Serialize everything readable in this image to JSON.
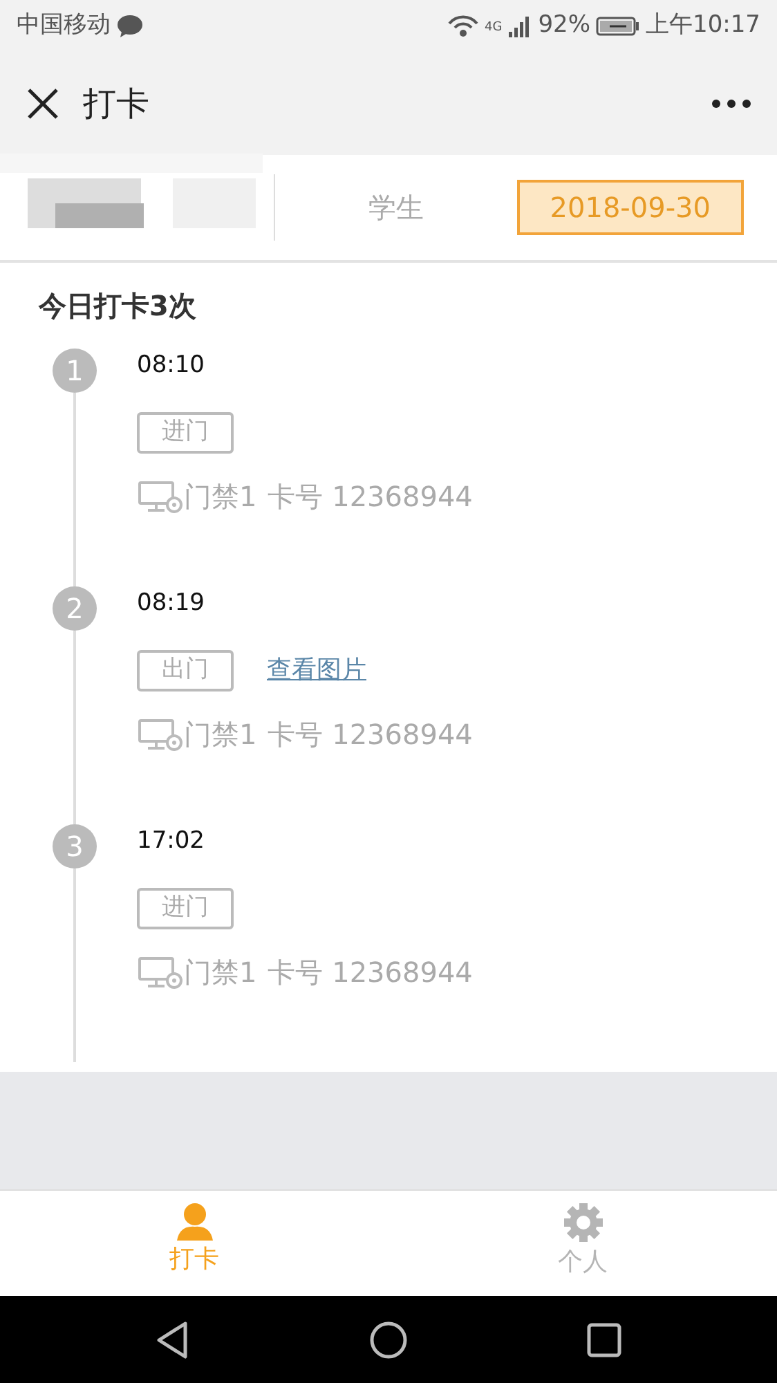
{
  "status_bar": {
    "carrier": "中国移动",
    "network": "4G",
    "battery": "92%",
    "time": "上午10:17"
  },
  "header": {
    "title": "打卡"
  },
  "info": {
    "role": "学生",
    "date": "2018-09-30"
  },
  "summary": "今日打卡3次",
  "records": [
    {
      "index": "1",
      "time": "08:10",
      "direction": "进门",
      "device": "门禁1",
      "card": "卡号 12368944"
    },
    {
      "index": "2",
      "time": "08:19",
      "direction": "出门",
      "link": "查看图片",
      "device": "门禁1",
      "card": "卡号 12368944"
    },
    {
      "index": "3",
      "time": "17:02",
      "direction": "进门",
      "device": "门禁1",
      "card": "卡号 12368944"
    }
  ],
  "tabs": [
    {
      "label": "打卡",
      "selected": true,
      "kind": "person"
    },
    {
      "label": "个人",
      "selected": false,
      "kind": "gear"
    }
  ]
}
